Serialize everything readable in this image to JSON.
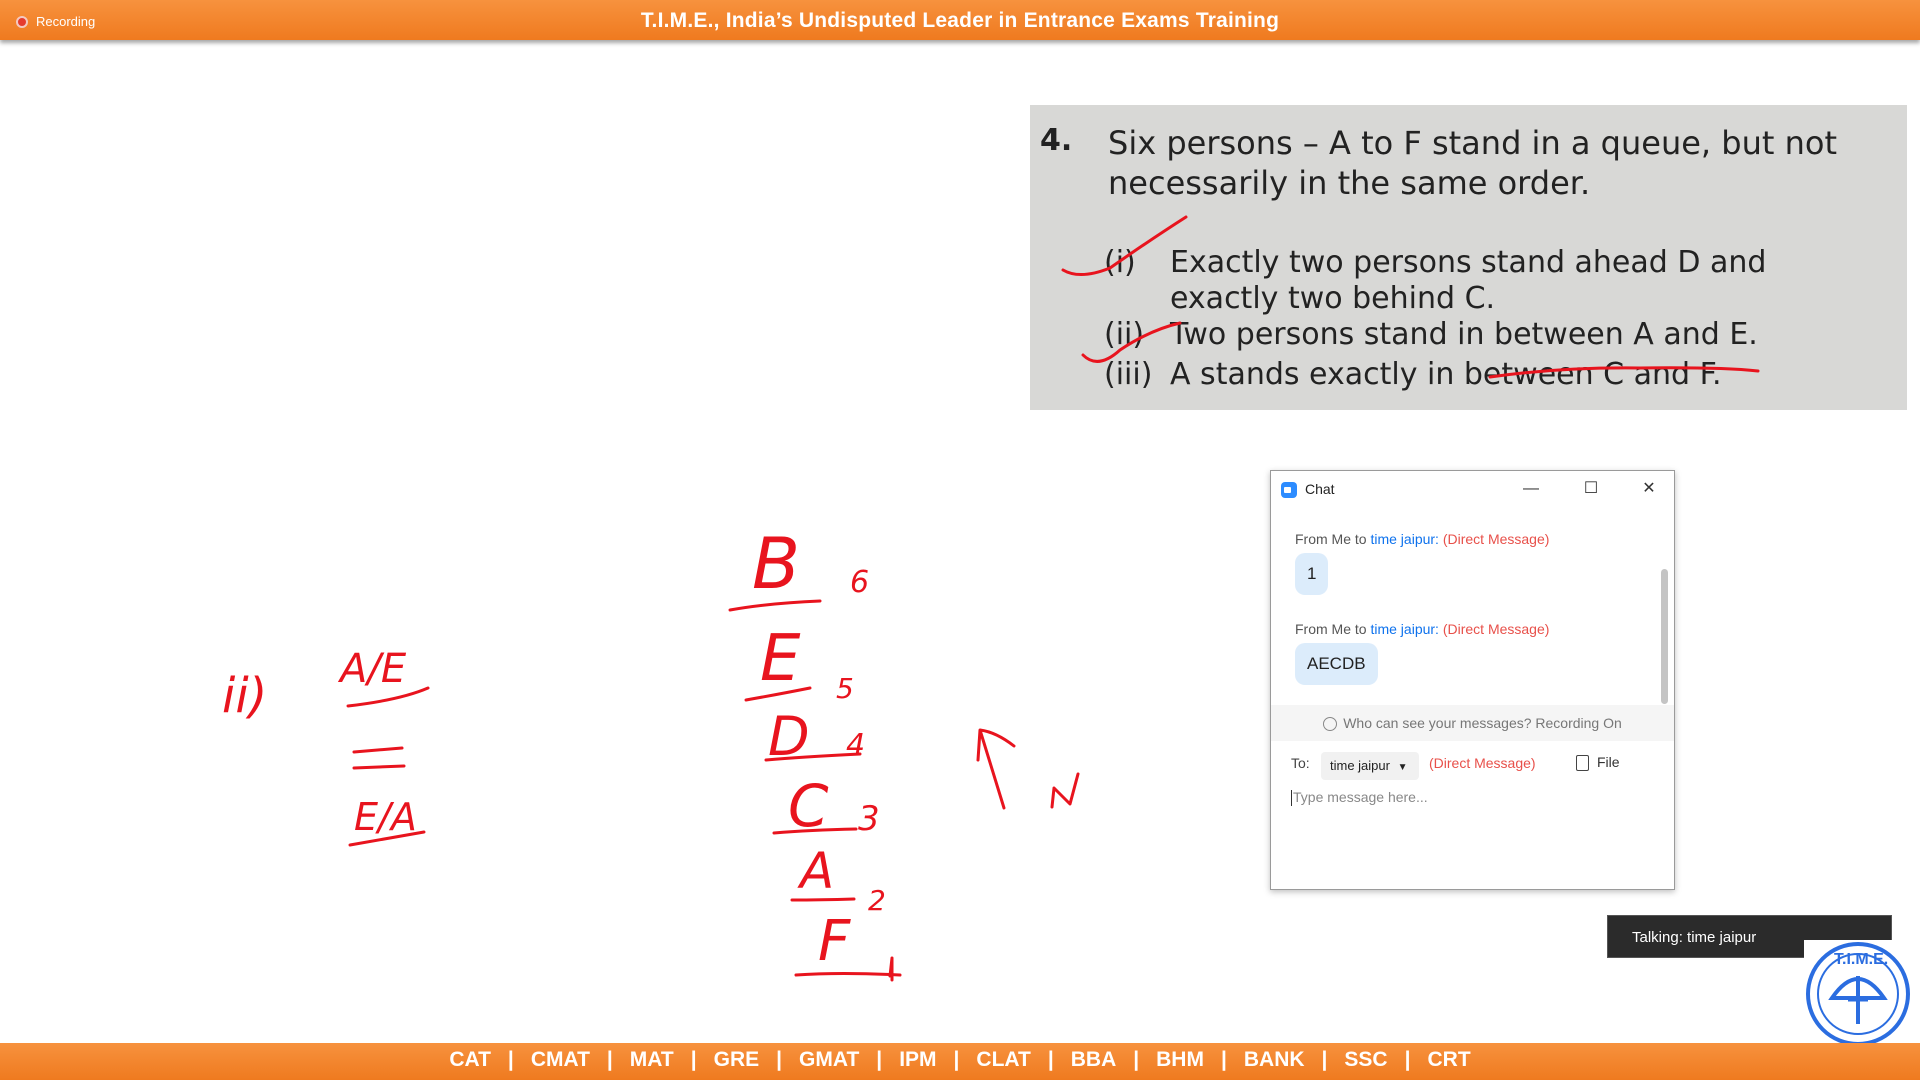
{
  "header": {
    "recording_label": "Recording",
    "title": "T.I.M.E., India’s Undisputed Leader in Entrance Exams Training"
  },
  "question": {
    "number": "4.",
    "stem": "Six persons – A to F stand in a queue, but not necessarily in the same order.",
    "items": [
      {
        "label": "(i)",
        "text": "Exactly two persons stand ahead D and exactly two behind C."
      },
      {
        "label": "(ii)",
        "text": "Two persons stand in between A and E."
      },
      {
        "label": "(iii)",
        "text": "A stands exactly in between C and F."
      }
    ]
  },
  "whiteboard": {
    "notes_left": [
      "ii)",
      "A/E",
      "E/A"
    ],
    "queue_letters": [
      "B",
      "E",
      "D",
      "C",
      "A",
      "F"
    ],
    "queue_numbers": [
      "6",
      "5",
      "4",
      "3",
      "2",
      "1"
    ]
  },
  "chat": {
    "title": "Chat",
    "messages": [
      {
        "from": "From Me to",
        "to": "time jaipur:",
        "tag": "(Direct Message)",
        "body": "1"
      },
      {
        "from": "From Me to",
        "to": "time jaipur:",
        "tag": "(Direct Message)",
        "body": "AECDB"
      }
    ],
    "privacy_notice": "Who can see your messages? Recording On",
    "to_label": "To:",
    "recipient": "time jaipur",
    "recipient_tag": "(Direct Message)",
    "file_label": "File",
    "compose_placeholder": "Type message here..."
  },
  "toast": {
    "text": "Talking: time jaipur"
  },
  "logo": {
    "text": "T.I.M.E."
  },
  "footer": {
    "exams": [
      "CAT",
      "CMAT",
      "MAT",
      "GRE",
      "GMAT",
      "IPM",
      "CLAT",
      "BBA",
      "BHM",
      "BANK",
      "SSC",
      "CRT"
    ],
    "separator": "|"
  },
  "colors": {
    "accent_orange": "#f08025",
    "ink_red": "#e8141e",
    "zoom_blue": "#2d8cff"
  }
}
